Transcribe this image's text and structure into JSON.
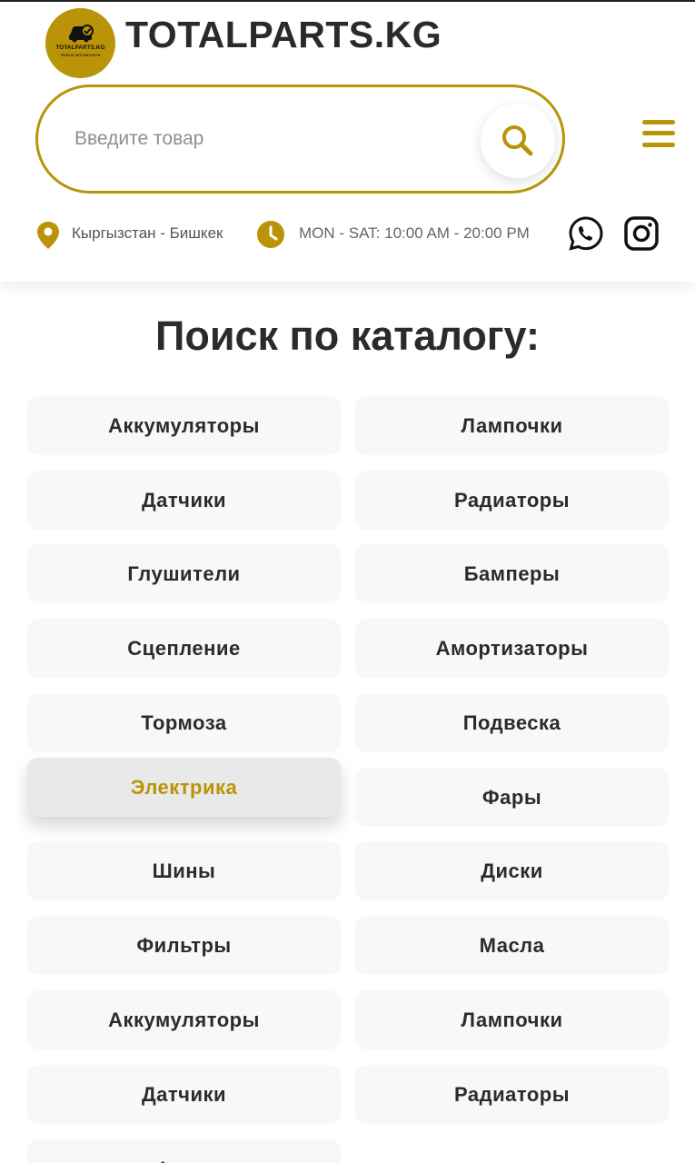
{
  "header": {
    "brand": "TOTALPARTS.KG",
    "logo": {
      "text": "TOTALPARTS.KG",
      "subtext": "Любые автозапчасти"
    },
    "search": {
      "placeholder": "Введите товар"
    },
    "location": "Кыргызстан - Бишкек",
    "hours": "MON - SAT: 10:00 AM - 20:00 PM"
  },
  "colors": {
    "accent": "#b99408",
    "button_bg": "#f8f8f8",
    "text": "#2b2b2b"
  },
  "icons": [
    "search-icon",
    "menu-icon",
    "location-pin-icon",
    "clock-icon",
    "whatsapp-icon",
    "instagram-icon"
  ],
  "catalog": {
    "title": "Поиск по каталогу:",
    "active_item": "Электрика",
    "items": [
      "Аккумуляторы",
      "Лампочки",
      "Датчики",
      "Радиаторы",
      "Глушители",
      "Бамперы",
      "Сцепление",
      "Амортизаторы",
      "Тормоза",
      "Подвеска",
      "Электрика",
      "Фары",
      "Шины",
      "Диски",
      "Фильтры",
      "Масла",
      "Аккумуляторы",
      "Лампочки",
      "Датчики",
      "Радиаторы",
      "Фары"
    ]
  }
}
